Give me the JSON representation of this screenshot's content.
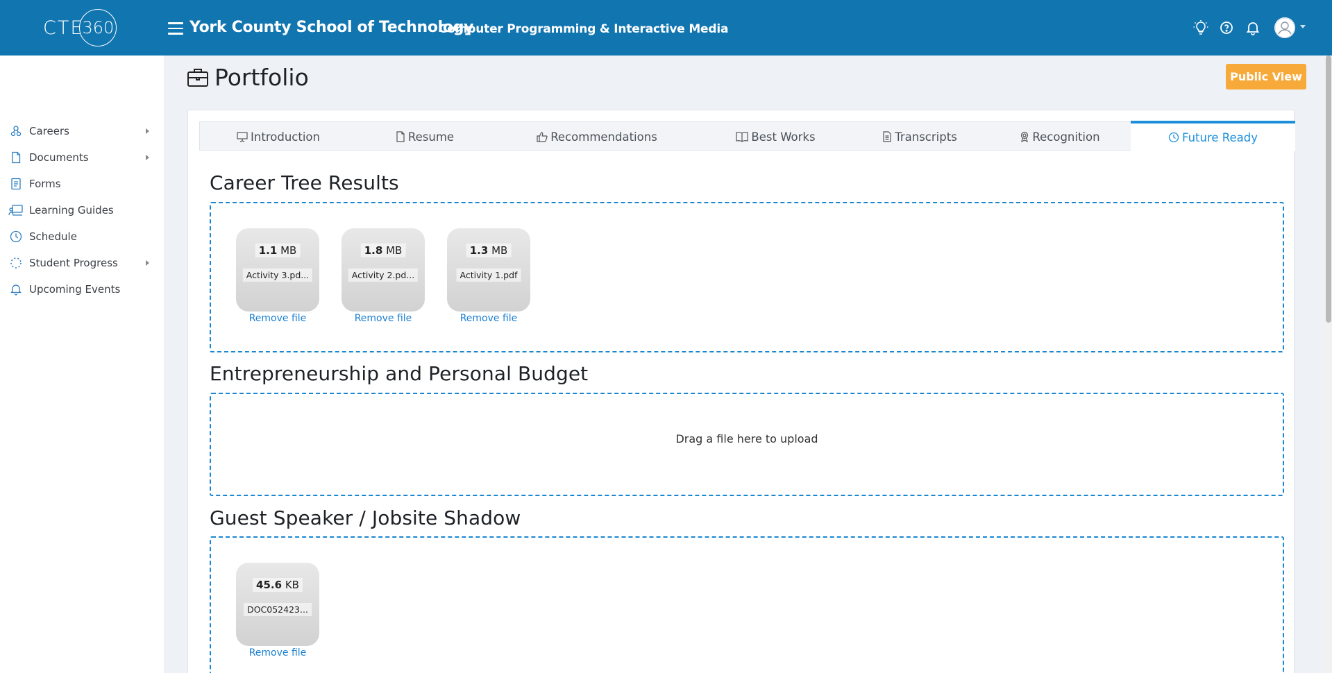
{
  "header": {
    "logo_text": "CTE",
    "logo_ring_text": "360",
    "school": "York County School of Technology",
    "program": "Computer Programming & Interactive Media",
    "icons": [
      "lightbulb-icon",
      "help-icon",
      "bell-icon",
      "user-avatar-icon"
    ]
  },
  "sidebar": {
    "items": [
      {
        "label": "Careers",
        "icon": "careers-icon",
        "has_submenu": true
      },
      {
        "label": "Documents",
        "icon": "document-icon",
        "has_submenu": true
      },
      {
        "label": "Forms",
        "icon": "form-icon",
        "has_submenu": false
      },
      {
        "label": "Learning Guides",
        "icon": "learning-guides-icon",
        "has_submenu": false
      },
      {
        "label": "Schedule",
        "icon": "clock-icon",
        "has_submenu": false
      },
      {
        "label": "Student Progress",
        "icon": "progress-icon",
        "has_submenu": true
      },
      {
        "label": "Upcoming Events",
        "icon": "bell-icon",
        "has_submenu": false
      }
    ]
  },
  "page": {
    "title": "Portfolio",
    "public_view_label": "Public View"
  },
  "tabs": [
    {
      "label": "Introduction",
      "icon": "presentation-icon"
    },
    {
      "label": "Resume",
      "icon": "file-icon"
    },
    {
      "label": "Recommendations",
      "icon": "thumbs-up-icon"
    },
    {
      "label": "Best Works",
      "icon": "book-icon"
    },
    {
      "label": "Transcripts",
      "icon": "file-text-icon"
    },
    {
      "label": "Recognition",
      "icon": "award-icon"
    },
    {
      "label": "Future Ready",
      "icon": "clock-icon",
      "active": true
    }
  ],
  "sections": [
    {
      "title": "Career Tree Results",
      "files": [
        {
          "size_value": "1.1",
          "size_unit": "MB",
          "name": "Activity 3.pd...",
          "remove_label": "Remove file"
        },
        {
          "size_value": "1.8",
          "size_unit": "MB",
          "name": "Activity 2.pd...",
          "remove_label": "Remove file"
        },
        {
          "size_value": "1.3",
          "size_unit": "MB",
          "name": "Activity 1.pdf",
          "remove_label": "Remove file"
        }
      ]
    },
    {
      "title": "Entrepreneurship and Personal Budget",
      "empty_hint": "Drag a file here to upload",
      "files": []
    },
    {
      "title": "Guest Speaker / Jobsite Shadow",
      "files": [
        {
          "size_value": "45.6",
          "size_unit": "KB",
          "name": "DOC052423...",
          "remove_label": "Remove file"
        }
      ]
    }
  ],
  "colors": {
    "header_bg": "#1175b0",
    "accent": "#1c8fdb",
    "public_view_btn": "#f7a93a"
  }
}
